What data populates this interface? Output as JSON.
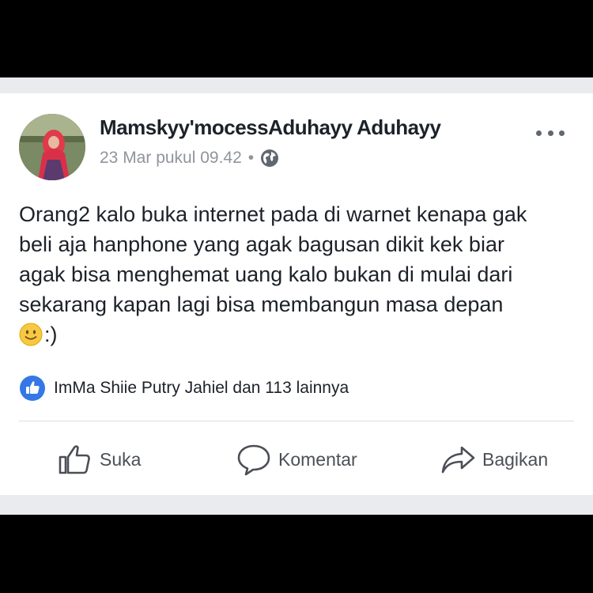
{
  "post": {
    "author": "Mamskyy'mocessAduhayy Aduhayy",
    "timestamp": "23 Mar pukul 09.42",
    "separator": "•",
    "privacy_icon": "globe-icon",
    "text_lines": [
      "Orang2 kalo buka internet pada di warnet kenapa gak",
      "beli aja hanphone yang agak bagusan dikit kek biar",
      "agak bisa menghemat uang kalo bukan di mulai dari",
      "sekarang kapan lagi bisa membangun masa depan"
    ],
    "text_end": ":)",
    "emoji": "slightly-smiling-face-emoji"
  },
  "reactions": {
    "icon": "like-reaction-icon",
    "text": "ImMa Shiie Putry Jahiel dan 113 lainnya"
  },
  "actions": {
    "like_label": "Suka",
    "comment_label": "Komentar",
    "share_label": "Bagikan"
  },
  "colors": {
    "background": "#000000",
    "card": "#ffffff",
    "frame": "#e9ebee",
    "primary_text": "#1d2129",
    "secondary_text": "#90949c",
    "action_text": "#4b4f56",
    "like_blue": "#3578e5"
  }
}
